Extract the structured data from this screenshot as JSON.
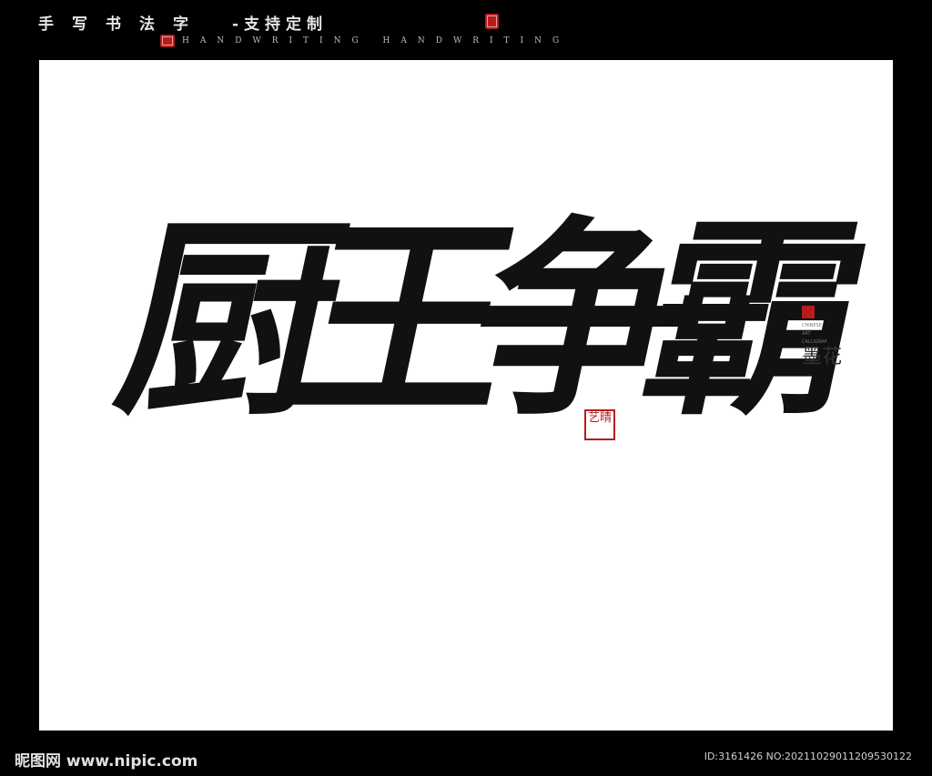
{
  "header": {
    "title": "手写书法字",
    "title_suffix": "-支持定制",
    "subtitle": "HANDWRITING HANDWRITING"
  },
  "artwork": {
    "calligraphy_text": "厨王争霸",
    "stamp_text": "艺晴",
    "signature_lines": [
      "CHINESE",
      "ART",
      "CALLIGRAP"
    ],
    "signature_glyph": "墨花"
  },
  "footer": {
    "site_logo": "昵图网 www.nipic.com",
    "image_id": "ID:3161426 NO:20211029011209530122"
  },
  "colors": {
    "background": "#000000",
    "canvas": "#ffffff",
    "seal_red": "#b71c1c"
  }
}
